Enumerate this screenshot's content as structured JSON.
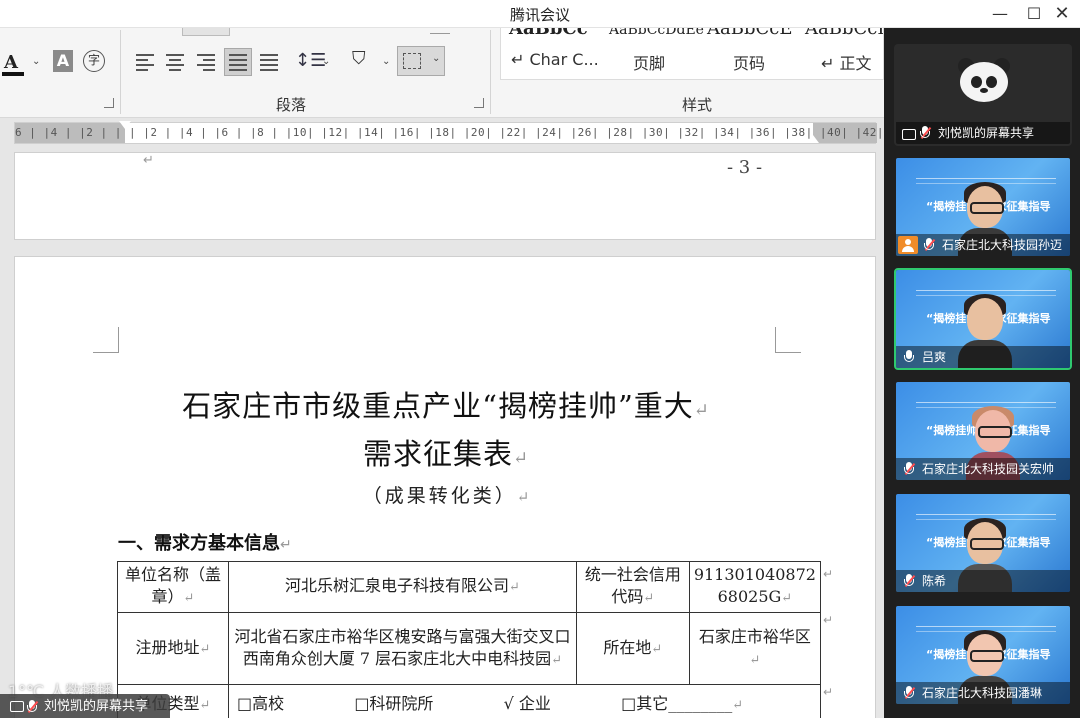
{
  "app": {
    "title": "腾讯会议",
    "window_controls": {
      "minimize": "—",
      "maximize": "☐",
      "close": "✕"
    }
  },
  "ribbon": {
    "paragraph_label": "段落",
    "styles_label": "样式",
    "styles": [
      {
        "preview": "AaBbCc",
        "label": "↵ Char C..."
      },
      {
        "preview": "AaBbCcDdEe",
        "label": "页脚"
      },
      {
        "preview": "AaBbCcE",
        "label": "页码"
      },
      {
        "preview": "AaBbCcD",
        "label": "↵ 正文"
      }
    ],
    "font_color_letter": "A",
    "highlight_letter": "A",
    "pinyin_glyph": "字",
    "dropdown_glyph": "⌄"
  },
  "ruler": {
    "ticks": "6 | |4 | |2 | |    | |2 | |4 | |6 | |8 | |10| |12| |14| |16| |18| |20| |22| |24| |26| |28| |30| |32| |34| |36| |38| |40| |42|"
  },
  "page1": {
    "page_number": "- 3 -",
    "paragraph_mark": "↵"
  },
  "document": {
    "title_line1": "石家庄市市级重点产业“揭榜挂帅”重大",
    "title_line2": "需求征集表",
    "subtitle": "（成果转化类）",
    "section_heading": "一、需求方基本信息",
    "paragraph_mark": "↵",
    "table": {
      "row1": {
        "label": "单位名称（盖章）",
        "value": "河北乐树汇泉电子科技有限公司",
        "label2": "统一社会信用代码",
        "value2": "911301040872 68025G"
      },
      "row2": {
        "label": "注册地址",
        "value": "河北省石家庄市裕华区槐安路与富强大街交叉口西南角众创大厦 7 层石家庄北大中电科技园",
        "label2": "所在地",
        "value2": "石家庄市裕华区"
      },
      "row3": {
        "label": "单位类型",
        "opt1": "□高校",
        "opt2": "□科研院所",
        "opt3": "√ 企业",
        "opt4": "□其它________"
      }
    }
  },
  "participants": [
    {
      "name": "刘悦凯的屏幕共享",
      "kind": "screen-share"
    },
    {
      "name": "石家庄北大科技园孙迈",
      "kind": "video"
    },
    {
      "name": "吕爽",
      "kind": "video-speaking"
    },
    {
      "name": "石家庄北大科技园关宏帅",
      "kind": "video"
    },
    {
      "name": "陈希",
      "kind": "video"
    },
    {
      "name": "石家庄北大科技园潘琳",
      "kind": "video"
    }
  ],
  "banner_text": "“揭榜挂帅”需求征集指导",
  "overlay": {
    "share_name": "刘悦凯的屏幕共享",
    "watermark": "1°℃ 人数播播"
  }
}
